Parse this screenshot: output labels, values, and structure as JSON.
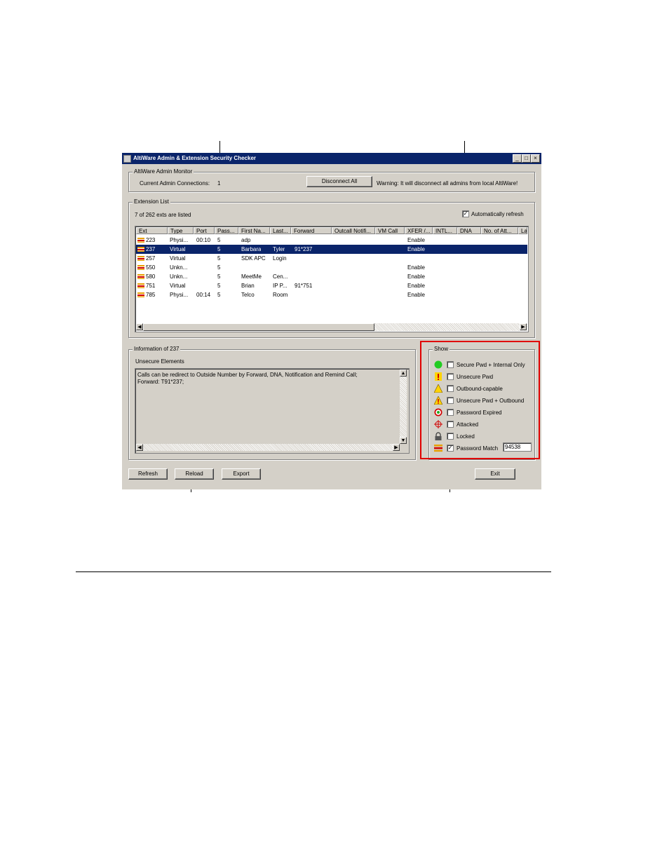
{
  "window": {
    "title": "AltiWare Admin & Extension Security Checker",
    "minimize": "_",
    "maximize": "□",
    "close": "×"
  },
  "admin_monitor": {
    "group_label": "AltiWare Admin Monitor",
    "connections_label": "Current Admin Connections:",
    "connections_value": "1",
    "disconnect_button": "Disconnect All",
    "warning": "Warning:  It will disconnect all admins from local AltiWare!"
  },
  "extension_list": {
    "group_label": "Extension List",
    "count_text": "7 of 262 exts are listed",
    "auto_refresh_label": "Automatically refresh",
    "auto_refresh_checked": true,
    "columns": [
      "Ext",
      "Type",
      "Port",
      "Pass...",
      "First Na...",
      "Last...",
      "Forward",
      "Outcall Notifi...",
      "VM Call",
      "XFER /...",
      "INTL...",
      "DNA",
      "No. of Att...",
      "La"
    ],
    "rows": [
      {
        "ext": "223",
        "type": "Physi...",
        "port": "00:10",
        "pass": "5",
        "first": "adp",
        "last": "",
        "forward": "",
        "xfer": "Enable",
        "selected": false
      },
      {
        "ext": "237",
        "type": "Virtual",
        "port": "",
        "pass": "5",
        "first": "Barbara",
        "last": "Tyler",
        "forward": "91*237",
        "xfer": "Enable",
        "selected": true
      },
      {
        "ext": "257",
        "type": "Virtual",
        "port": "",
        "pass": "5",
        "first": "SDK APC",
        "last": "Login",
        "forward": "",
        "xfer": "",
        "selected": false
      },
      {
        "ext": "550",
        "type": "Unkn...",
        "port": "",
        "pass": "5",
        "first": "",
        "last": "",
        "forward": "",
        "xfer": "Enable",
        "selected": false
      },
      {
        "ext": "580",
        "type": "Unkn...",
        "port": "",
        "pass": "5",
        "first": "MeetMe",
        "last": "Cen...",
        "forward": "",
        "xfer": "Enable",
        "selected": false
      },
      {
        "ext": "751",
        "type": "Virtual",
        "port": "",
        "pass": "5",
        "first": "Brian",
        "last": "IP P...",
        "forward": "91*751",
        "xfer": "Enable",
        "selected": false
      },
      {
        "ext": "785",
        "type": "Physi...",
        "port": "00:14",
        "pass": "5",
        "first": "Telco",
        "last": "Room",
        "forward": "",
        "xfer": "Enable",
        "selected": false
      }
    ]
  },
  "info": {
    "group_label": "Information of 237",
    "subtitle": "Unsecure Elements",
    "line1": "Calls can be redirect to Outside Number by Forward, DNA, Notification and Remind Call;",
    "line2": "Forward: T91*237;"
  },
  "show": {
    "group_label": "Show",
    "items": [
      {
        "label": "Secure Pwd + Internal Only",
        "icon": "green-circle-icon",
        "checked": false
      },
      {
        "label": "Unsecure Pwd",
        "icon": "red-exclamation-icon",
        "checked": false
      },
      {
        "label": "Outbound-capable",
        "icon": "yellow-warning-icon",
        "checked": false
      },
      {
        "label": "Unsecure Pwd + Outbound",
        "icon": "red-warning-icon",
        "checked": false
      },
      {
        "label": "Password Expired",
        "icon": "expired-clock-icon",
        "checked": false
      },
      {
        "label": "Attacked",
        "icon": "target-icon",
        "checked": false
      },
      {
        "label": "Locked",
        "icon": "lock-icon",
        "checked": false
      },
      {
        "label": "Password Match",
        "icon": "match-bars-icon",
        "checked": true
      }
    ],
    "password_match_value": "94538"
  },
  "buttons": {
    "refresh": "Refresh",
    "reload": "Reload",
    "export": "Export",
    "exit": "Exit"
  },
  "colors": {
    "titlebar": "#0a246a",
    "window_bg": "#d4d0c8",
    "highlight_box": "#e00000",
    "selection": "#0a246a"
  }
}
